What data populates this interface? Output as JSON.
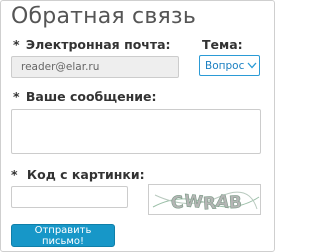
{
  "form": {
    "title": "Обратная связь",
    "required_mark": "*",
    "email": {
      "label": "Электронная почта:",
      "value": "reader@elar.ru"
    },
    "topic": {
      "label": "Тема:",
      "selected": "Вопрос",
      "chevron_icon": "chevron-down-icon"
    },
    "message": {
      "label": "Ваше сообщение:",
      "value": ""
    },
    "captcha": {
      "label": "Код с картинки:",
      "value": "",
      "image_text": "CWRAB"
    },
    "submit_label": "Отправить письмо!",
    "colors": {
      "accent": "#1797c8",
      "select_border": "#2b9bd6",
      "select_text": "#1a7fc1",
      "readonly_bg": "#eeeeee"
    }
  }
}
